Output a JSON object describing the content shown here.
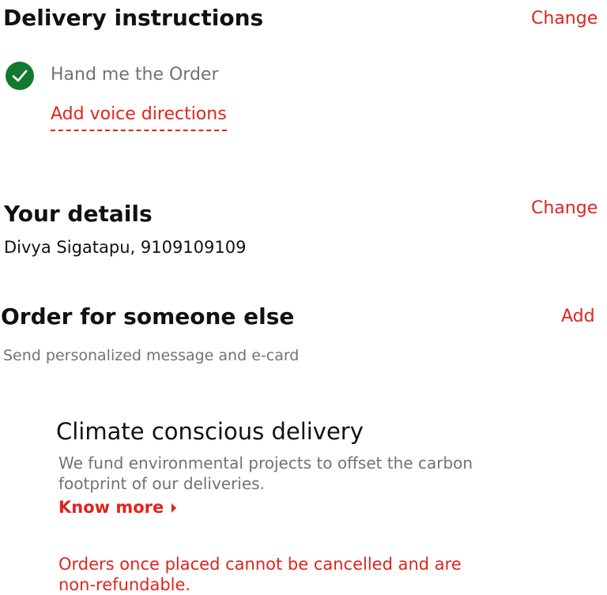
{
  "delivery_instructions": {
    "title": "Delivery instructions",
    "change_label": "Change",
    "selected_option": "Hand me the Order",
    "voice_link": "Add voice directions",
    "check_icon": "check-circle-icon",
    "check_color": "#127a2e"
  },
  "your_details": {
    "title": "Your details",
    "change_label": "Change",
    "info": "Divya Sigatapu, 9109109109"
  },
  "order_for_someone": {
    "title": "Order for someone else",
    "add_label": "Add",
    "subtitle": "Send personalized message and e-card"
  },
  "climate": {
    "title": "Climate conscious delivery",
    "description": "We fund environmental projects to offset the carbon footprint of our deliveries.",
    "know_more": "Know more",
    "caret_icon": "caret-right-icon"
  },
  "notice": {
    "text": "Orders once placed cannot be cancelled and are non-refundable."
  },
  "colors": {
    "accent": "#e0241d",
    "muted_text": "#7a6f6f",
    "heading": "#111111",
    "success": "#127a2e"
  }
}
